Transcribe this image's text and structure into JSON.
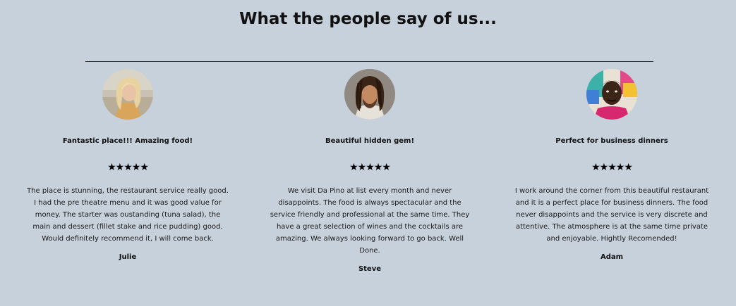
{
  "section": {
    "heading": "What the people say of us..."
  },
  "reviews": [
    {
      "title": "Fantastic place!!! Amazing food!",
      "rating": 5,
      "stars": "★★★★★",
      "text": "The place is stunning, the restaurant service really good. I had the pre theatre menu and it was good value for money. The starter was oustanding (tuna salad), the main and dessert (fillet stake and rice pudding) good. Would definitely recommend it, I will come back.",
      "author": "Julie",
      "avatar_icon": "woman-portrait-icon"
    },
    {
      "title": "Beautiful hidden gem!",
      "rating": 5,
      "stars": "★★★★★",
      "text": "We visit Da Pino at list every month and never disappoints. The food is always spectacular and the service friendly and professional at the same time. They have a great selection of wines and the cocktails are amazing. We always looking forward to go back. Well Done.",
      "author": "Steve",
      "avatar_icon": "man-dreadlocks-portrait-icon"
    },
    {
      "title": "Perfect for business dinners",
      "rating": 5,
      "stars": "★★★★★",
      "text": "I work around the corner from this beautiful restaurant and it is a perfect place for business dinners. The food never disappoints and the service is very discrete and attentive. The atmosphere is at the same time private and enjoyable. Hightly Recomended!",
      "author": "Adam",
      "avatar_icon": "man-colorful-portrait-icon"
    }
  ],
  "colors": {
    "background": "#c7d1dc",
    "text": "#111111",
    "divider": "#2b2b2b"
  }
}
